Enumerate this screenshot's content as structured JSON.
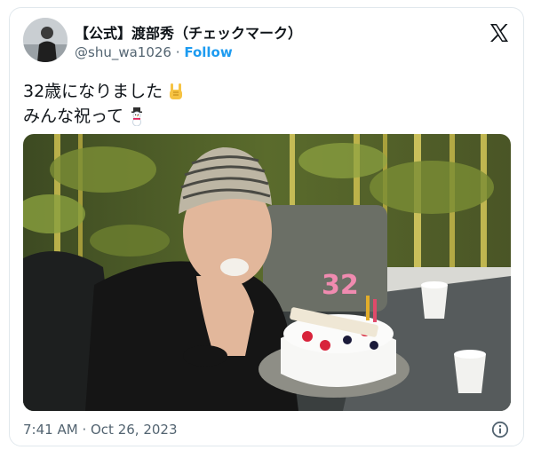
{
  "author": {
    "display_name": "【公式】渡部秀（チェックマーク）",
    "handle": "@shu_wa1026",
    "separator": "·",
    "follow_label": "Follow"
  },
  "tweet": {
    "line1": "32歳になりました",
    "line2": "みんな祝って"
  },
  "icons": {
    "brand": "x-logo-icon",
    "line1_emoji": "rock-on-hand-emoji",
    "line2_emoji": "snowman-emoji",
    "info": "info-icon"
  },
  "colors": {
    "follow": "#1d9bf0",
    "secondary_text": "#536471",
    "border": "#e1e8ed"
  },
  "photo": {
    "cake_candles": "32"
  },
  "meta": {
    "time": "7:41 AM",
    "separator": "·",
    "date": "Oct 26, 2023"
  }
}
